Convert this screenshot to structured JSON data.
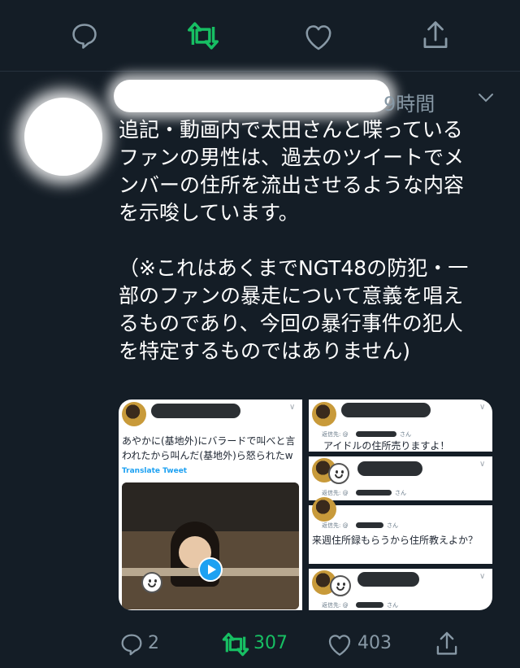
{
  "colors": {
    "background": "#141d26",
    "text": "#ffffff",
    "muted": "#8899a6",
    "retweet_active": "#17bf63",
    "link": "#1da1f2"
  },
  "top_actions": {
    "icons": [
      "reply-icon",
      "retweet-icon",
      "like-icon",
      "share-icon"
    ],
    "retweet_active": true
  },
  "tweet": {
    "time": "9時間",
    "text": "追記・動画内で太田さんと喋っている\nファンの男性は、過去のツイートでメ\nンバーの住所を流出させるような内容\nを示唆しています。\n\n（※これはあくまでNGT48の防犯・一\n部のファンの暴走について意義を唱え\nるものであり、今回の暴行事件の犯人\nを特定するものではありません)",
    "media": {
      "left": {
        "tweet_text": "あやかに(基地外)にバラードで叫べと言われたから叫んだ(基地外)ら怒られたw",
        "translate_label": "Translate Tweet"
      },
      "right": {
        "reply_prefix": "返信先: @",
        "reply_suffix": "さん",
        "text_1": "アイドルの住所売りますよ！",
        "text_2": "来週住所録もらうから住所教えよか？"
      }
    }
  },
  "bottom_actions": {
    "reply_count": "2",
    "retweet_count": "307",
    "like_count": "403"
  }
}
